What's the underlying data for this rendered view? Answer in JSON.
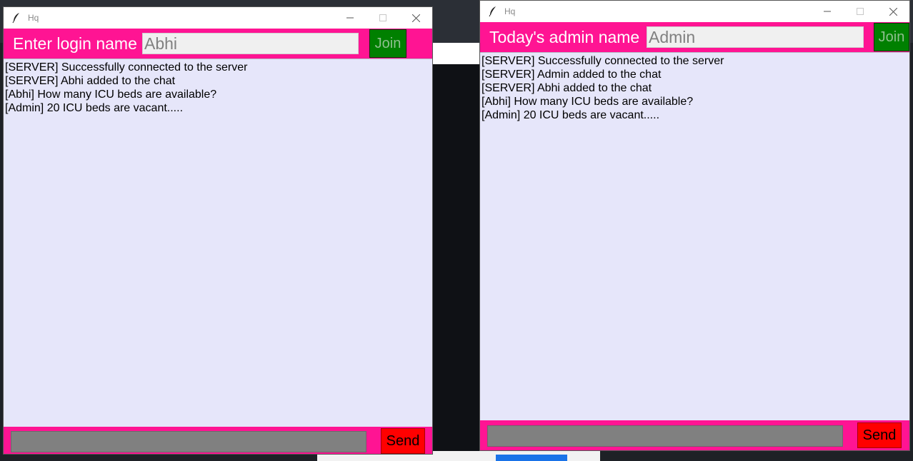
{
  "colors": {
    "header_bg": "#ff1493",
    "chat_bg": "#e6e6fa",
    "join_bg": "#008000",
    "send_bg": "#ff0000",
    "input_bg": "#808080"
  },
  "client_window": {
    "title": "Hq",
    "icon": "feather-icon",
    "header": {
      "label": "Enter login name",
      "name_value": "Abhi",
      "join_label": "Join"
    },
    "messages": [
      "[SERVER] Successfully connected to the server",
      "[SERVER] Abhi added to the chat",
      "[Abhi] How many ICU beds are available?",
      "[Admin] 20 ICU beds are vacant....."
    ],
    "send_label": "Send",
    "message_value": ""
  },
  "admin_window": {
    "title": "Hq",
    "icon": "feather-icon",
    "header": {
      "label": "Today's admin name",
      "name_value": "Admin",
      "join_label": "Join"
    },
    "messages": [
      "[SERVER] Successfully connected to the server",
      "[SERVER] Admin added to the chat",
      "[SERVER] Abhi added to the chat",
      "[Abhi] How many ICU beds are available?",
      "[Admin] 20 ICU beds are vacant....."
    ],
    "send_label": "Send",
    "message_value": ""
  }
}
